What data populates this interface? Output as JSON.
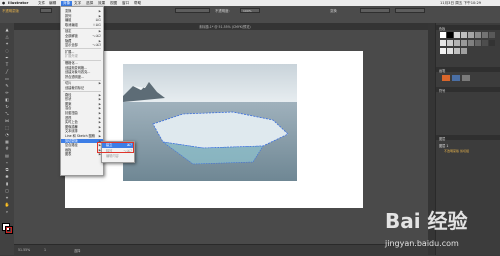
{
  "mac_menubar": {
    "app_name": "Illustrator",
    "menus": [
      "文件",
      "编辑",
      "对象",
      "文字",
      "选择",
      "效果",
      "视图",
      "窗口",
      "帮助"
    ],
    "clock": "11月3日 周五 下午10:29"
  },
  "control_bar": {
    "selection_label": "不透明蒙版",
    "style_label": "描边:",
    "opacity_label": "不透明度:",
    "opacity_value": "100%",
    "transform_label": "变换"
  },
  "doc_tab": {
    "title": "未标题-1* @ 51.55% (CMYK/预览)"
  },
  "object_menu": {
    "items": [
      {
        "label": "变换",
        "shortcut": "",
        "submenu": true,
        "state": "normal"
      },
      {
        "label": "排列",
        "shortcut": "",
        "submenu": true,
        "state": "normal"
      },
      {
        "label": "编组",
        "shortcut": "⌘G",
        "submenu": false,
        "state": "normal"
      },
      {
        "label": "取消编组",
        "shortcut": "⇧⌘G",
        "submenu": false,
        "state": "normal"
      },
      {
        "label": "锁定",
        "shortcut": "",
        "submenu": true,
        "state": "normal"
      },
      {
        "label": "全部解锁",
        "shortcut": "⌥⌘2",
        "submenu": false,
        "state": "normal"
      },
      {
        "label": "隐藏",
        "shortcut": "",
        "submenu": true,
        "state": "normal"
      },
      {
        "label": "显示全部",
        "shortcut": "⌥⌘3",
        "submenu": false,
        "state": "normal"
      },
      {
        "label": "扩展...",
        "shortcut": "",
        "submenu": false,
        "state": "normal"
      },
      {
        "label": "扩展外观",
        "shortcut": "",
        "submenu": false,
        "state": "disabled"
      },
      {
        "label": "栅格化...",
        "shortcut": "",
        "submenu": false,
        "state": "normal"
      },
      {
        "label": "创建渐变网格...",
        "shortcut": "",
        "submenu": false,
        "state": "normal"
      },
      {
        "label": "创建对象马赛克...",
        "shortcut": "",
        "submenu": false,
        "state": "normal"
      },
      {
        "label": "拼合透明度...",
        "shortcut": "",
        "submenu": false,
        "state": "normal"
      },
      {
        "label": "切片",
        "shortcut": "",
        "submenu": true,
        "state": "normal"
      },
      {
        "label": "创建裁切标记",
        "shortcut": "",
        "submenu": false,
        "state": "normal"
      },
      {
        "label": "路径",
        "shortcut": "",
        "submenu": true,
        "state": "normal"
      },
      {
        "label": "形状",
        "shortcut": "",
        "submenu": true,
        "state": "normal"
      },
      {
        "label": "图案",
        "shortcut": "",
        "submenu": true,
        "state": "normal"
      },
      {
        "label": "混合",
        "shortcut": "",
        "submenu": true,
        "state": "normal"
      },
      {
        "label": "封套扭曲",
        "shortcut": "",
        "submenu": true,
        "state": "normal"
      },
      {
        "label": "透视",
        "shortcut": "",
        "submenu": true,
        "state": "normal"
      },
      {
        "label": "实时上色",
        "shortcut": "",
        "submenu": true,
        "state": "normal"
      },
      {
        "label": "图像描摹",
        "shortcut": "",
        "submenu": true,
        "state": "normal"
      },
      {
        "label": "文本绕排",
        "shortcut": "",
        "submenu": true,
        "state": "normal"
      },
      {
        "label": "Line 和 Sketch 图稿",
        "shortcut": "",
        "submenu": true,
        "state": "normal"
      },
      {
        "label": "剪切蒙版",
        "shortcut": "",
        "submenu": true,
        "state": "highlighted"
      },
      {
        "label": "复合路径",
        "shortcut": "",
        "submenu": true,
        "state": "normal"
      },
      {
        "label": "画板",
        "shortcut": "",
        "submenu": true,
        "state": "normal"
      },
      {
        "label": "图表",
        "shortcut": "",
        "submenu": true,
        "state": "normal"
      }
    ]
  },
  "clipping_submenu": {
    "items": [
      {
        "label": "建立",
        "shortcut": "⌘7",
        "state": "highlighted"
      },
      {
        "label": "释放",
        "shortcut": "⌥⌘7",
        "state": "disabled"
      },
      {
        "label": "编辑内容",
        "shortcut": "",
        "state": "disabled"
      }
    ]
  },
  "right_panel": {
    "headers": [
      "色板",
      "画笔",
      "符号",
      "图层"
    ],
    "layer_name": "图层 1",
    "layer_item": "不透明蒙版 剪切组"
  },
  "status_bar": {
    "zoom": "51.55%",
    "page": "1",
    "tool": "选择"
  },
  "watermark": {
    "brand": "Bai 经验",
    "url": "jingyan.baidu.com"
  },
  "colors": {
    "accent": "#3d7ee6",
    "highlight_box": "#e0352b",
    "path_outline": "#3b6fe0"
  }
}
